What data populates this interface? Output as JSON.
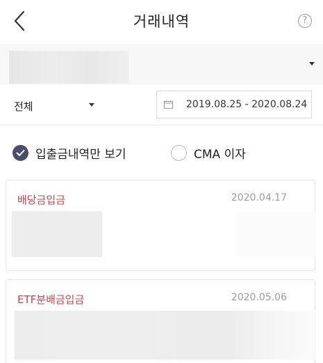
{
  "header": {
    "title": "거래내역",
    "help_label": "?"
  },
  "filters": {
    "type_label": "전체",
    "date_range": "2019.08.25 - 2020.08.24"
  },
  "options": {
    "deposit_only_label": "입출금내역만 보기",
    "deposit_only_checked": true,
    "cma_label": "CMA 이자",
    "cma_checked": false
  },
  "transactions": [
    {
      "title": "배당금입금",
      "date": "2020.04.17"
    },
    {
      "title": "ETF분배금입금",
      "date": "2020.05.06"
    }
  ],
  "colors": {
    "accent": "#c0474f",
    "check": "#4a4e6c"
  }
}
